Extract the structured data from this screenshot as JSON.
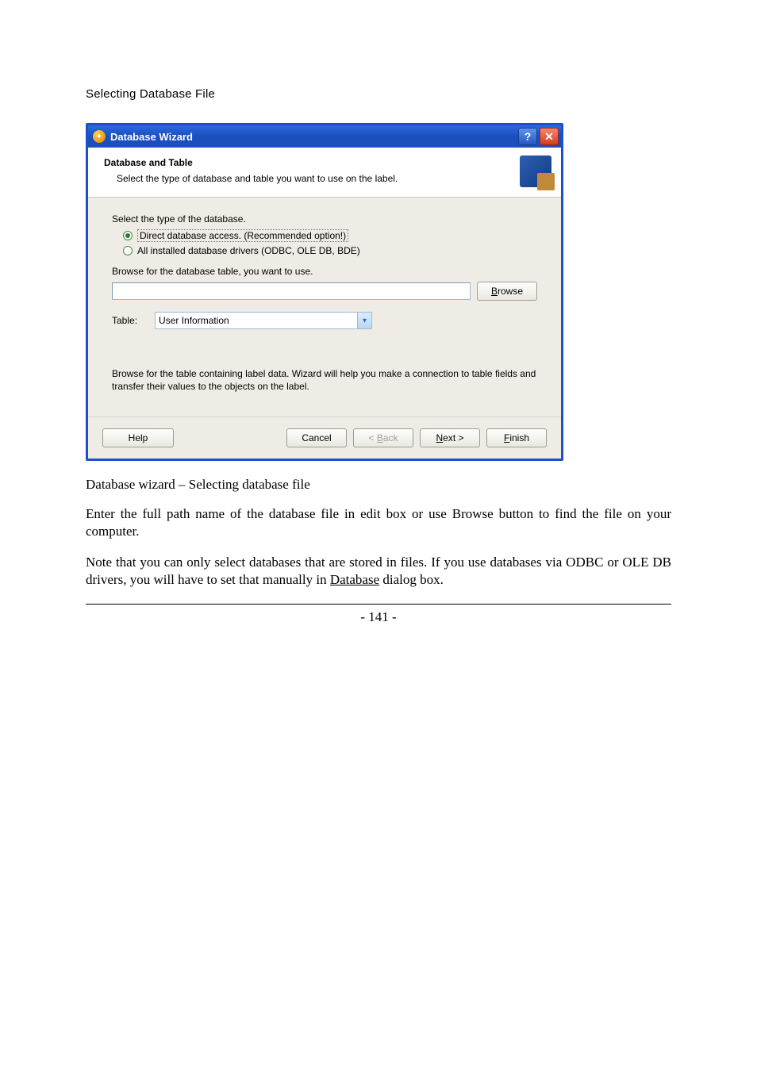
{
  "doc": {
    "section_heading": "Selecting Database File",
    "caption": "Database wizard – Selecting database file",
    "para1": "Enter the full path name of the database file in edit box or use Browse button to find the file on your computer.",
    "para2_pre": "Note that you can only select databases that are stored in files. If you use databases via ODBC or OLE DB drivers, you will have to set that manually in ",
    "para2_link": "Database",
    "para2_post": " dialog box.",
    "page_number": "- 141 -"
  },
  "window": {
    "title": "Database Wizard",
    "header": {
      "title": "Database and Table",
      "subtitle": "Select the type of database and table you want to use on the label."
    },
    "body": {
      "type_label": "Select the type of the database.",
      "radio1": "Direct database access. (Recommended option!)",
      "radio2": "All installed database drivers (ODBC, OLE DB, BDE)",
      "browse_label": "Browse for the database table, you want to use.",
      "browse_button_pre": "",
      "browse_button_u": "B",
      "browse_button_post": "rowse",
      "table_label": "Table:",
      "table_value": "User Information",
      "info": "Browse for the table containing label data. Wizard will help you make a connection to table fields and transfer their values to the objects on the label."
    },
    "footer": {
      "help": "Help",
      "cancel": "Cancel",
      "back_pre": "< ",
      "back_u": "B",
      "back_post": "ack",
      "next_u": "N",
      "next_post": "ext >",
      "finish_u": "F",
      "finish_post": "inish"
    }
  }
}
